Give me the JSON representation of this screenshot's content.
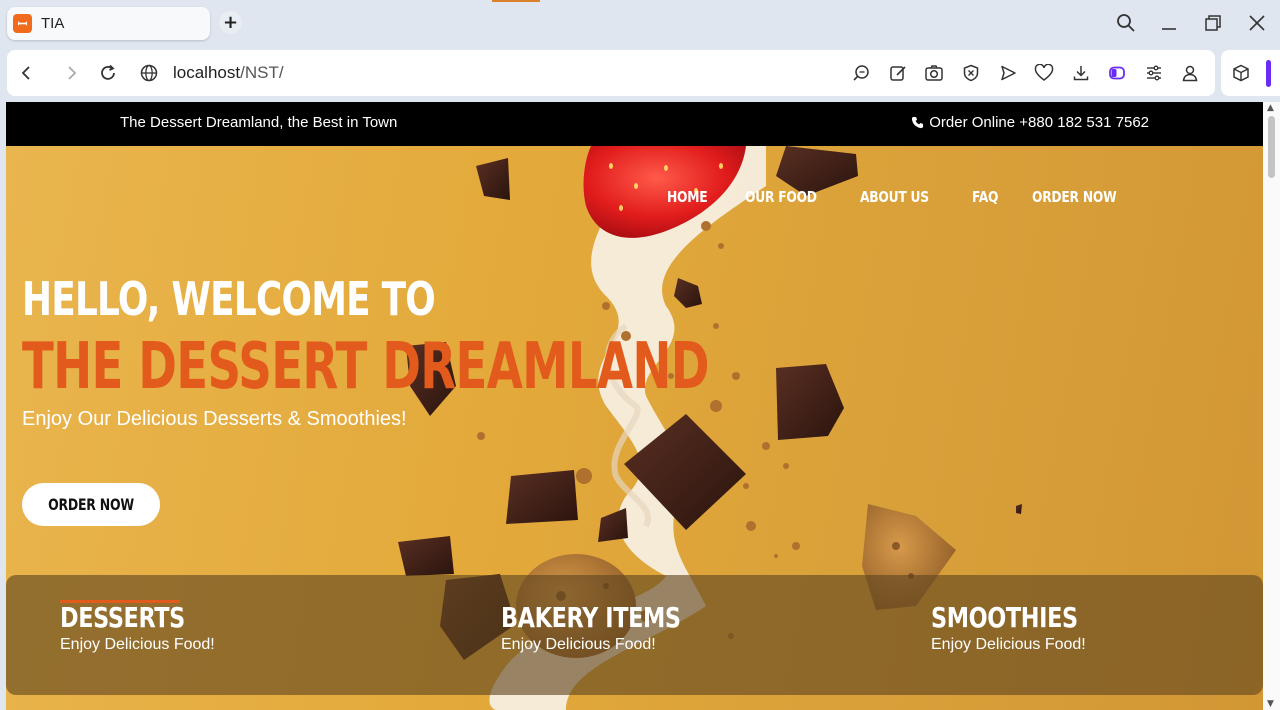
{
  "browser": {
    "tab_title": "TIA",
    "favicon": "xampp-icon",
    "new_tab": "+",
    "url_host": "localhost",
    "url_path": "/NST/"
  },
  "site": {
    "tagline": "The Dessert Dreamland, the Best in Town",
    "phone_text": "Order Online +880 182 531 7562",
    "nav": [
      "HOME",
      "OUR FOOD",
      "ABOUT US",
      "FAQ",
      "ORDER NOW"
    ],
    "hero": {
      "greeting": "HELLO, WELCOME TO",
      "brand": "THE DESSERT DREAMLAND",
      "subtitle": "Enjoy Our Delicious Desserts & Smoothies!",
      "cta": "ORDER NOW"
    },
    "features": [
      {
        "title": "DESSERTS",
        "subtitle": "Enjoy Delicious Food!"
      },
      {
        "title": "BAKERY ITEMS",
        "subtitle": "Enjoy Delicious Food!"
      },
      {
        "title": "SMOOTHIES",
        "subtitle": "Enjoy Delicious Food!"
      }
    ]
  },
  "colors": {
    "accent": "#e35b1c",
    "hero_bg": "#e3ad3a",
    "topbar": "#000000"
  }
}
